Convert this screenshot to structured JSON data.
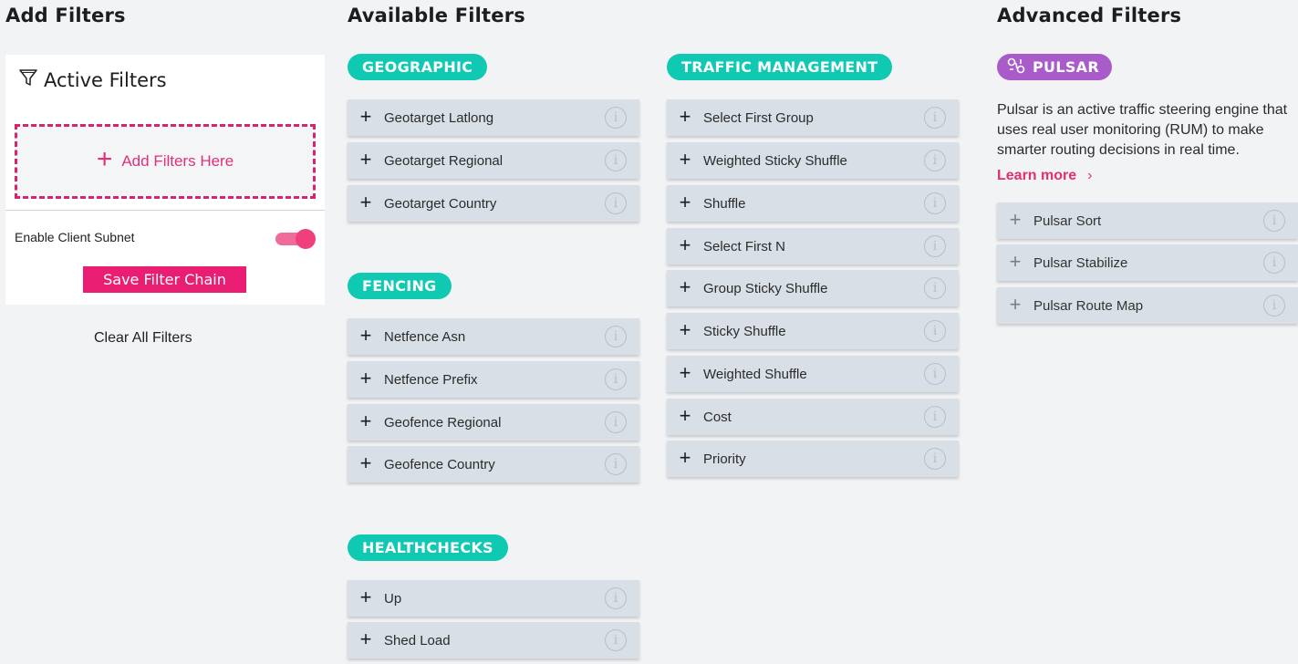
{
  "headings": {
    "add_filters": "Add Filters",
    "available_filters": "Available Filters",
    "advanced_filters": "Advanced Filters"
  },
  "active_panel": {
    "title": "Active Filters",
    "title_icon": "funnel-icon",
    "dropzone_label": "Add Filters Here",
    "subnet_label": "Enable Client Subnet",
    "subnet_enabled": true,
    "save_label": "Save Filter Chain",
    "clear_label": "Clear All Filters"
  },
  "categories": {
    "geographic": {
      "label": "GEOGRAPHIC",
      "items": [
        "Geotarget Latlong",
        "Geotarget Regional",
        "Geotarget Country"
      ]
    },
    "fencing": {
      "label": "FENCING",
      "items": [
        "Netfence Asn",
        "Netfence Prefix",
        "Geofence Regional",
        "Geofence Country"
      ]
    },
    "healthchecks": {
      "label": "HEALTHCHECKS",
      "items": [
        "Up",
        "Shed Load"
      ]
    },
    "traffic": {
      "label": "TRAFFIC MANAGEMENT",
      "items": [
        "Select First Group",
        "Weighted Sticky Shuffle",
        "Shuffle",
        "Select First N",
        "Group Sticky Shuffle",
        "Sticky Shuffle",
        "Weighted Shuffle",
        "Cost",
        "Priority"
      ]
    }
  },
  "advanced": {
    "pill_label": "PULSAR",
    "pill_icon": "pulsar-icon",
    "description": "Pulsar is an active traffic steering engine that uses real user monitoring (RUM) to make smarter routing decisions in real time.",
    "learn_more": "Learn more",
    "items": [
      "Pulsar Sort",
      "Pulsar Stabilize",
      "Pulsar Route Map"
    ]
  },
  "symbols": {
    "plus": "+",
    "info": "i",
    "chevron": "›"
  },
  "colors": {
    "accent_pink": "#e91e72",
    "teal": "#10c9b2",
    "purple": "#a85bc9",
    "row_bg": "#d9dfe6",
    "page_bg": "#f2f3f5"
  }
}
